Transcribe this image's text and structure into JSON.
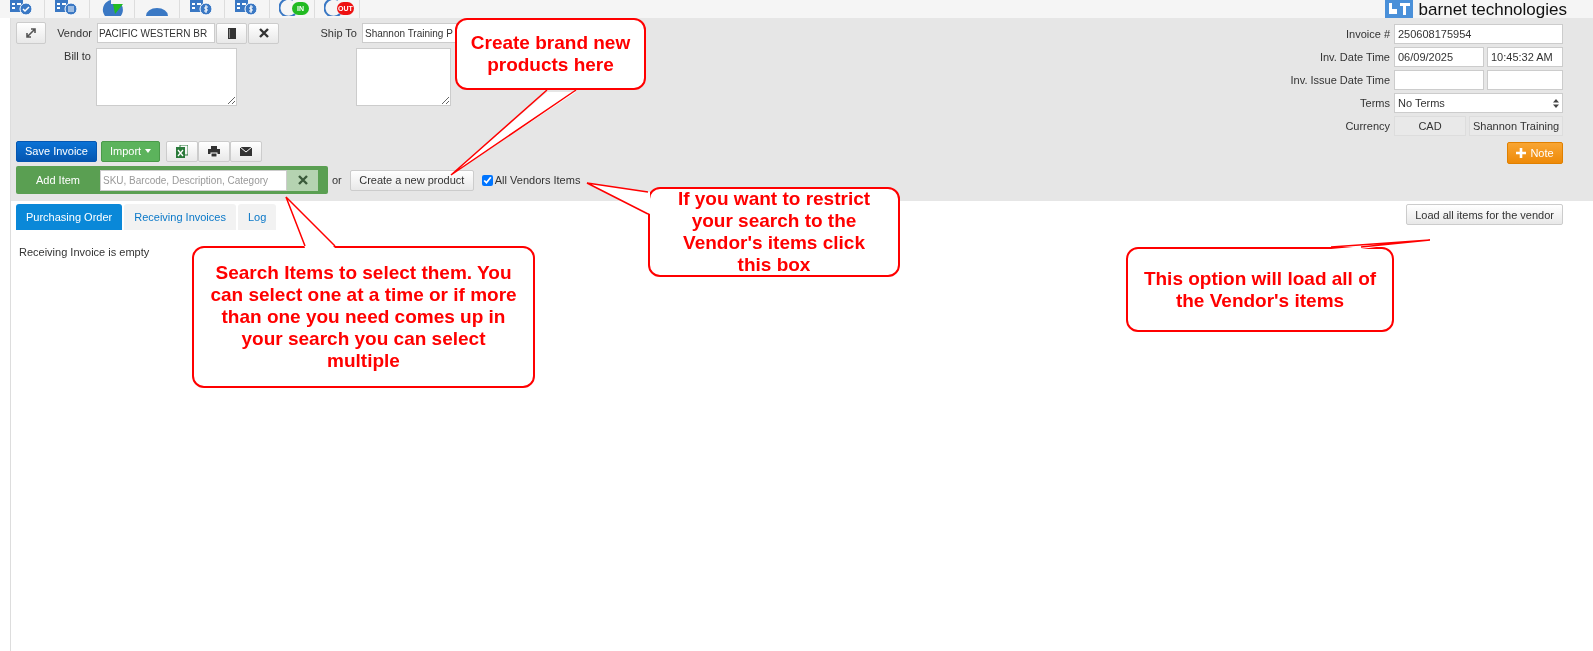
{
  "nav": [
    {
      "kind": "doc-check"
    },
    {
      "kind": "doc-list"
    },
    {
      "kind": "pie"
    },
    {
      "kind": "user"
    },
    {
      "kind": "doc-dollar"
    },
    {
      "kind": "doc-dollar"
    },
    {
      "kind": "clock",
      "badge": "IN",
      "color": "#22bb22"
    },
    {
      "kind": "clock",
      "badge": "OUT",
      "color": "#ee1111"
    }
  ],
  "brand": "barnet technologies",
  "vendor": {
    "label": "Vendor",
    "value": "PACIFIC WESTERN BR"
  },
  "bill_to": {
    "label": "Bill to"
  },
  "ship_to": {
    "label": "Ship To",
    "value": "Shannon Training P"
  },
  "invoice_fields": [
    {
      "label": "Invoice #",
      "values": [
        "250608175954"
      ],
      "kind": "text"
    },
    {
      "label": "Inv. Date Time",
      "values": [
        "06/09/2025",
        "10:45:32 AM"
      ],
      "kind": "pair"
    },
    {
      "label": "Inv. Issue Date Time",
      "kind": "pair"
    },
    {
      "label": "Terms",
      "values": [
        "No Terms"
      ],
      "kind": "select"
    },
    {
      "label": "Currency",
      "values": [
        "CAD",
        "Shannon Training"
      ],
      "kind": "readonly"
    }
  ],
  "note_button": "Note",
  "actions": {
    "save": "Save Invoice",
    "import": "Import"
  },
  "add_item": {
    "label": "Add Item",
    "placeholder": "SKU, Barcode, Description, Category",
    "or": "or",
    "create": "Create a new product",
    "all_vendors": {
      "label": "All Vendors Items",
      "checked": true
    }
  },
  "tabs": [
    {
      "label": "Purchasing Order",
      "selected": true
    },
    {
      "label": "Receiving Invoices",
      "selected": false
    },
    {
      "label": "Log",
      "selected": false
    }
  ],
  "load_all": "Load all items for the vendor",
  "empty_message": "Receiving Invoice is empty",
  "annotations": [
    {
      "text": "Create brand new products here"
    },
    {
      "text": "If you want to restrict your search to the Vendor's items click this box"
    },
    {
      "text": "Search Items to select them. You can select one at a time or if more than one you need comes up in your search you can select multiple"
    },
    {
      "text": "This option will load all of the Vendor's items"
    }
  ]
}
